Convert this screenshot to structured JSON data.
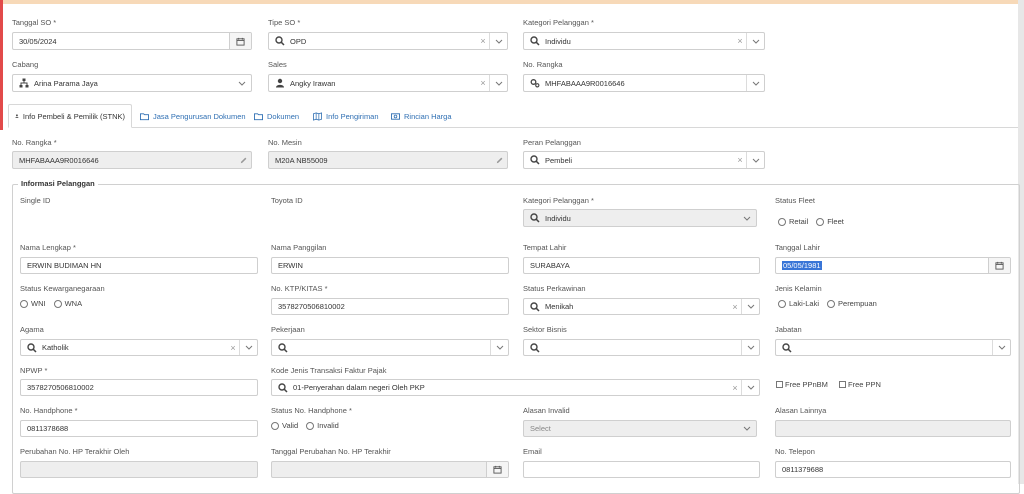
{
  "header": {
    "tanggal_so": {
      "label": "Tanggal SO *",
      "value": "30/05/2024"
    },
    "tipe_so": {
      "label": "Tipe SO *",
      "value": "OPD"
    },
    "kategori_pelanggan": {
      "label": "Kategori Pelanggan *",
      "value": "Individu"
    },
    "cabang": {
      "label": "Cabang",
      "value": "Arina Parama Jaya"
    },
    "sales": {
      "label": "Sales",
      "value": "Angky Irawan"
    },
    "no_rangka": {
      "label": "No. Rangka",
      "value": "MHFABAAA9R0016646"
    }
  },
  "tabs": [
    {
      "label": "Info Pembeli & Pemilik (STNK)"
    },
    {
      "label": "Jasa Pengurusan Dokumen"
    },
    {
      "label": "Dokumen"
    },
    {
      "label": "Info Pengiriman"
    },
    {
      "label": "Rincian Harga"
    }
  ],
  "vehicle": {
    "no_rangka": {
      "label": "No. Rangka *",
      "value": "MHFABAAA9R0016646"
    },
    "no_mesin": {
      "label": "No. Mesin",
      "value": "M20A NB55009"
    },
    "peran_pelanggan": {
      "label": "Peran Pelanggan",
      "value": "Pembeli"
    }
  },
  "info": {
    "legend": "Informasi Pelanggan",
    "single_id": {
      "label": "Single ID"
    },
    "toyota_id": {
      "label": "Toyota ID"
    },
    "kategori": {
      "label": "Kategori Pelanggan *",
      "value": "Individu"
    },
    "status_fleet": {
      "label": "Status Fleet",
      "opt1": "Retail",
      "opt2": "Fleet"
    },
    "nama_lengkap": {
      "label": "Nama Lengkap *",
      "value": "ERWIN BUDIMAN HN"
    },
    "nama_panggilan": {
      "label": "Nama Panggilan",
      "value": "ERWIN"
    },
    "tempat_lahir": {
      "label": "Tempat Lahir",
      "value": "SURABAYA"
    },
    "tanggal_lahir": {
      "label": "Tanggal Lahir",
      "value": "05/05/1981"
    },
    "kewarganegaraan": {
      "label": "Status Kewarganegaraan",
      "opt1": "WNI",
      "opt2": "WNA"
    },
    "ktp": {
      "label": "No. KTP/KITAS *",
      "value": "3578270506810002"
    },
    "perkawinan": {
      "label": "Status Perkawinan",
      "value": "Menikah"
    },
    "jenis_kelamin": {
      "label": "Jenis Kelamin",
      "opt1": "Laki-Laki",
      "opt2": "Perempuan"
    },
    "agama": {
      "label": "Agama",
      "value": "Katholik"
    },
    "pekerjaan": {
      "label": "Pekerjaan"
    },
    "sektor_bisnis": {
      "label": "Sektor Bisnis"
    },
    "jabatan": {
      "label": "Jabatan"
    },
    "npwp": {
      "label": "NPWP *",
      "value": "3578270506810002"
    },
    "kode_pajak": {
      "label": "Kode Jenis Transaksi Faktur Pajak",
      "value": "01-Penyerahan dalam negeri Oleh PKP"
    },
    "free_ppnbm": "Free PPnBM",
    "free_ppn": "Free PPN",
    "handphone": {
      "label": "No. Handphone *",
      "value": "0811378688"
    },
    "status_hp": {
      "label": "Status No. Handphone *",
      "opt1": "Valid",
      "opt2": "Invalid"
    },
    "alasan_invalid": {
      "label": "Alasan Invalid",
      "placeholder": "Select"
    },
    "alasan_lainnya": {
      "label": "Alasan Lainnya"
    },
    "perubahan_oleh": {
      "label": "Perubahan No. HP Terakhir Oleh"
    },
    "tanggal_perubahan": {
      "label": "Tanggal Perubahan No. HP Terakhir"
    },
    "email": {
      "label": "Email"
    },
    "telepon": {
      "label": "No. Telepon",
      "value": "0811379688"
    }
  }
}
